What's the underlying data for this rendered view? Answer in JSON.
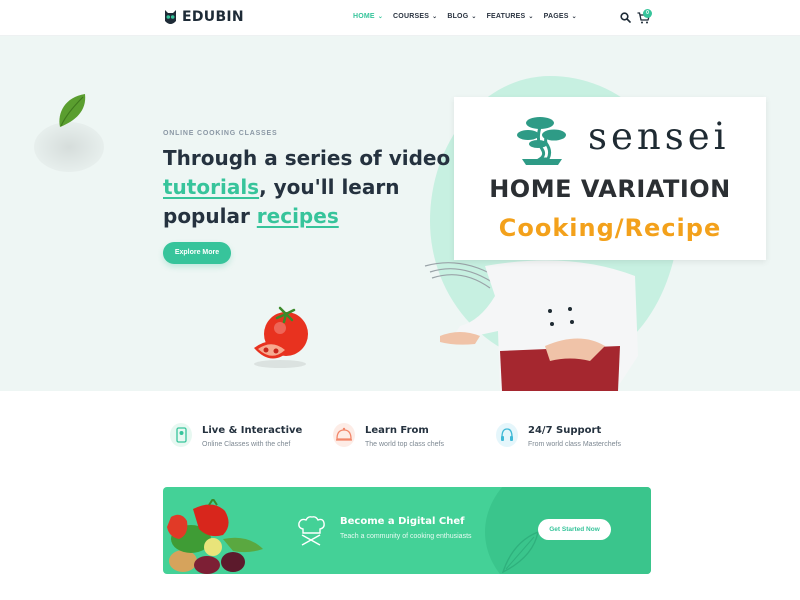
{
  "brand": {
    "name": "EDUBIN",
    "accent": "#37c49b"
  },
  "nav": {
    "items": [
      {
        "label": "HOME",
        "active": true
      },
      {
        "label": "COURSES",
        "active": false
      },
      {
        "label": "BLOG",
        "active": false
      },
      {
        "label": "FEATURES",
        "active": false
      },
      {
        "label": "PAGES",
        "active": false
      }
    ],
    "cart_count": "0"
  },
  "hero": {
    "eyebrow": "ONLINE COOKING CLASSES",
    "headline_part1": "Through a series of video ",
    "headline_hl1": "tutorials",
    "headline_part2": ", you'll learn popular ",
    "headline_hl2": "recipes",
    "cta": "Explore More"
  },
  "overlay": {
    "brand": "sensei",
    "line1": "HOME VARIATION",
    "line2": "Cooking/Recipe",
    "line2_color": "#f3a11b"
  },
  "features": [
    {
      "title": "Live & Interactive",
      "subtitle": "Online Classes with the chef",
      "icon": "video-call-icon"
    },
    {
      "title": "Learn From",
      "subtitle": "The world top class chefs",
      "icon": "cloche-icon"
    },
    {
      "title": "24/7 Support",
      "subtitle": "From world class Masterchefs",
      "icon": "support-icon"
    }
  ],
  "banner": {
    "title": "Become a Digital Chef",
    "subtitle": "Teach a community of cooking enthusiasts",
    "cta": "Get Started Now",
    "color": "#44d197"
  }
}
